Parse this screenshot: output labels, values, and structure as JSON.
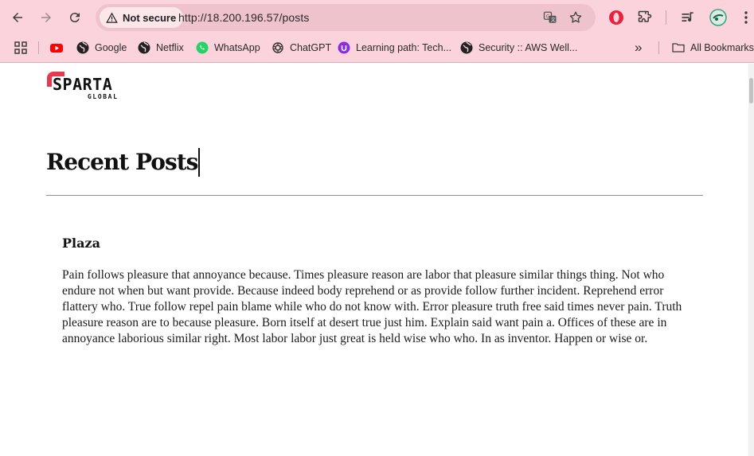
{
  "browser": {
    "security_label": "Not secure",
    "url": "http://18.200.196.57/posts",
    "bookmarks": [
      {
        "label": "",
        "icon": "youtube-icon"
      },
      {
        "label": "Google",
        "icon": "globe-icon"
      },
      {
        "label": "Netflix",
        "icon": "globe-icon"
      },
      {
        "label": "WhatsApp",
        "icon": "whatsapp-icon"
      },
      {
        "label": "ChatGPT",
        "icon": "chatgpt-icon"
      },
      {
        "label": "Learning path: Tech...",
        "icon": "learning-icon"
      },
      {
        "label": "Security :: AWS Well...",
        "icon": "globe-icon"
      }
    ],
    "overflow_label": "»",
    "all_bookmarks_label": "All Bookmarks",
    "colors": {
      "chrome": "#fbd3dc",
      "omnibox": "#eec3cc",
      "accent_red": "#e53950"
    }
  },
  "site": {
    "logo_word": "SPARTA",
    "logo_sub": "GLOBAL",
    "heading": "Recent Posts"
  },
  "posts": [
    {
      "title": "Plaza",
      "body": "Pain follows pleasure that annoyance because. Times pleasure reason are labor that pleasure similar things thing. Not who endure not when but want provide. Because indeed body reprehend or as provide follow further incident. Reprehend error flattery who. True follow repel pain blame while who do not know with. Error pleasure truth free said times never pain. Truth pleasure reason are to because pleasure. Born itself at desert true just him. Explain said want pain a. Offices of these are in annoyance laborious similar right. Most labor labor just great is held wise who who. In as inventor. Happen or wise or."
    }
  ]
}
